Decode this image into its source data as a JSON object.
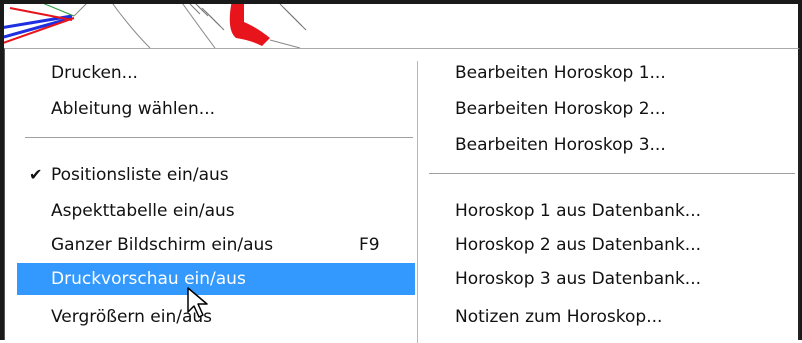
{
  "menu": {
    "left_items": [
      {
        "label": "Drucken..."
      },
      {
        "label": "Ableitung wählen..."
      },
      {
        "label": "Positionsliste ein/aus",
        "checked": true,
        "check_glyph": "✔"
      },
      {
        "label": "Aspekttabelle ein/aus"
      },
      {
        "label": "Ganzer Bildschirm ein/aus",
        "shortcut": "F9"
      },
      {
        "label": "Druckvorschau ein/aus",
        "selected": true
      },
      {
        "label": "Vergrößern ein/aus"
      }
    ],
    "right_items": [
      {
        "label": "Bearbeiten Horoskop 1..."
      },
      {
        "label": "Bearbeiten Horoskop 2..."
      },
      {
        "label": "Bearbeiten Horoskop 3..."
      },
      {
        "label": "Horoskop 1 aus Datenbank..."
      },
      {
        "label": "Horoskop 2 aus Datenbank..."
      },
      {
        "label": "Horoskop 3 aus Datenbank..."
      },
      {
        "label": "Notizen zum Horoskop..."
      }
    ]
  },
  "colors": {
    "highlight": "#3399ff",
    "highlight_text": "#ffffff",
    "chart_red": "#e8141c",
    "chart_blue": "#1d2fe0"
  },
  "icons": {
    "check": "check-icon",
    "cursor": "mouse-pointer-icon"
  }
}
